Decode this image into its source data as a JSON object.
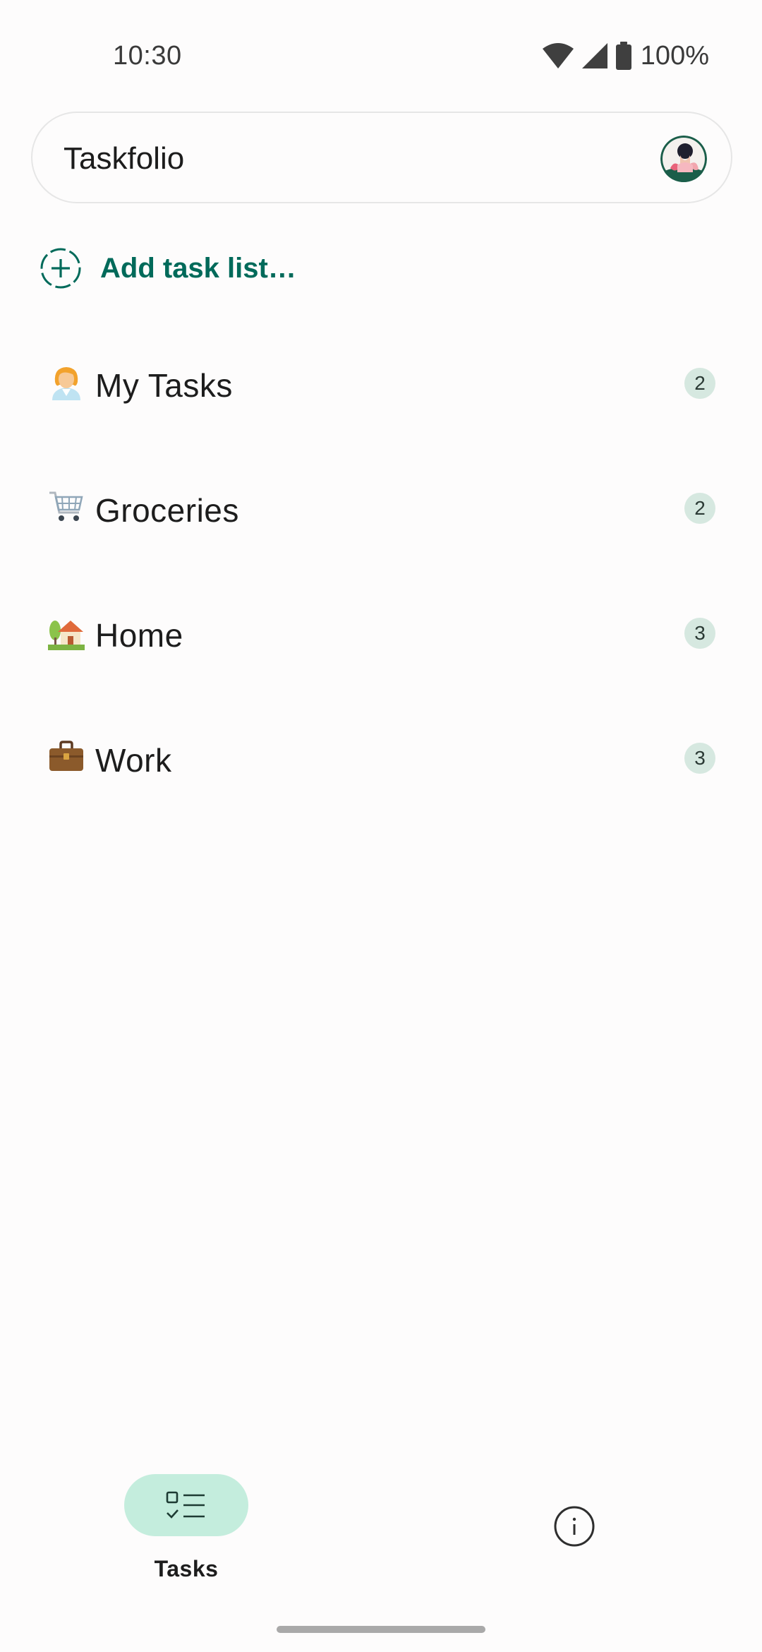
{
  "status_bar": {
    "time": "10:30",
    "battery": "100%",
    "icons": [
      "wifi-icon",
      "cell-signal-icon",
      "battery-icon"
    ]
  },
  "app_bar": {
    "title": "Taskfolio",
    "avatar_icon": "user-avatar"
  },
  "add_list": {
    "label": "Add task list…",
    "icon": "add-circle-dashed-icon",
    "color": "#006A5A"
  },
  "lists": [
    {
      "emoji": "👩‍💼",
      "label": "My Tasks",
      "count": "2"
    },
    {
      "emoji": "🛒",
      "label": "Groceries",
      "count": "2"
    },
    {
      "emoji": "🏡",
      "label": "Home",
      "count": "3"
    },
    {
      "emoji": "💼",
      "label": "Work",
      "count": "3"
    }
  ],
  "bottom_nav": {
    "tasks_label": "Tasks",
    "tasks_icon": "checklist-icon",
    "info_icon": "info-icon",
    "active_color": "#C4EDDD"
  },
  "colors": {
    "background": "#FDFCFC",
    "accent": "#006A5A",
    "badge": "#D6E8E0"
  }
}
